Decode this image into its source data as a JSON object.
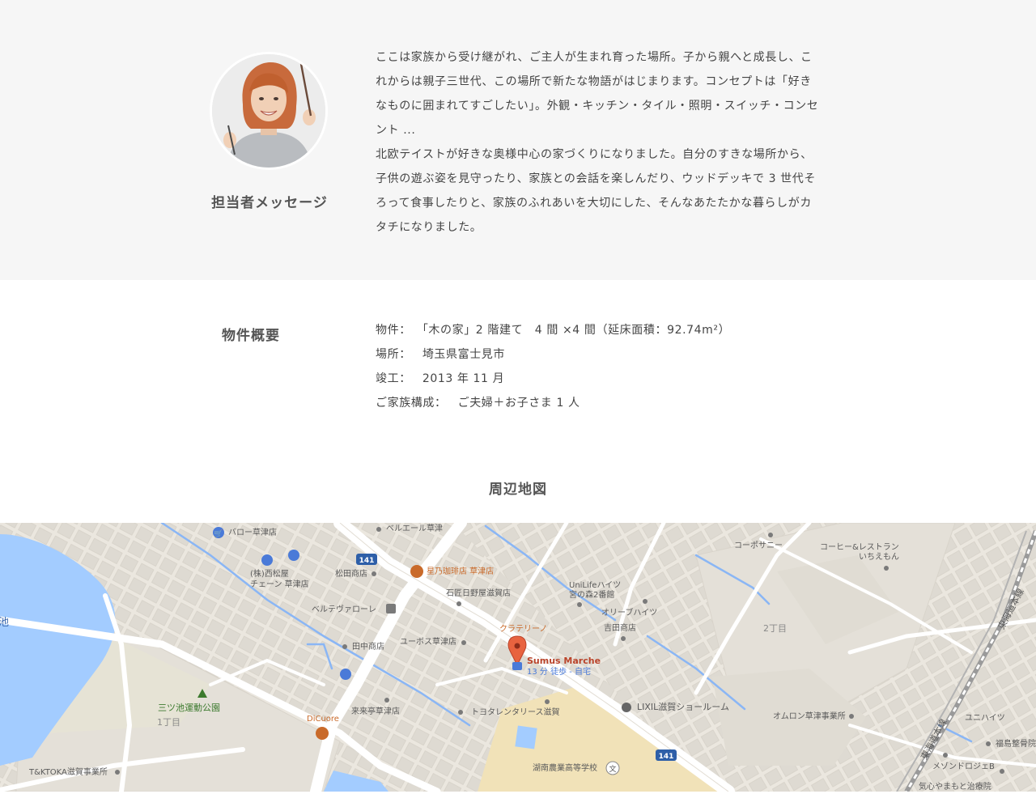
{
  "message": {
    "heading": "担当者メッセージ",
    "paragraphs": [
      "ここは家族から受け継がれ、ご主人が生まれ育った場所。子から親へと成長し、これからは親子三世代、この場所で新たな物語がはじまります。コンセプトは「好きなものに囲まれてすごしたい」。外観・キッチン・タイル・照明・スイッチ・コンセント ...",
      "北欧テイストが好きな奥様中心の家づくりになりました。自分のすきな場所から、子供の遊ぶ姿を見守ったり、家族との会話を楽しんだり、ウッドデッキで 3 世代そろって食事したりと、家族のふれあいを大切にした、そんなあたたかな暮らしがカタチになりました。"
    ]
  },
  "property": {
    "heading": "物件概要",
    "rows": [
      {
        "label": "物件：",
        "value": "「木の家」2 階建て　4 間 ×4 間（延床面積：92.74m²）"
      },
      {
        "label": "場所：",
        "value": "埼玉県富士見市"
      },
      {
        "label": "竣工：",
        "value": "2013 年 11 月"
      },
      {
        "label": "ご家族構成：",
        "value": "ご夫婦＋お子さま 1 人"
      }
    ]
  },
  "map": {
    "heading": "周辺地図",
    "labels": {
      "baro": "バロー草津店",
      "belair": "ベルエール草津",
      "route141a": "141",
      "route141b": "141",
      "nishimatsuya1": "(株)西松屋",
      "nishimatsuya2": "チェーン 草津店",
      "matsuda": "松田商店",
      "hoshino": "星乃珈琲店 草津店",
      "ishitaku": "石匠日野屋滋賀店",
      "unilife1": "UniLifeハイツ",
      "unilife2": "宮の森2番館",
      "olive": "オリーブハイツ",
      "coposunny": "コーポサニー",
      "coffee1": "コーヒー&レストラン",
      "coffee2": "いちえもん",
      "belteverole": "ベルテヴァローレ",
      "tanaka": "田中商店",
      "yubos": "ユーボス草津店",
      "clatelino": "クラテリーノ",
      "yoshida": "吉田商店",
      "chome2": "2丁目",
      "sumus": "Sumus Marche",
      "walk": "13 分 徒歩 - 自宅",
      "park": "三ツ池運動公園",
      "chome1": "1丁目",
      "dicuore": "DiCuore",
      "kuruku": "来来亭草津店",
      "toyota": "トヨタレンタリース滋賀",
      "lixil": "LIXIL滋賀ショールーム",
      "omron": "オムロン草津事業所",
      "tokaido1": "東海道本線",
      "tokaido2": "東海道本線",
      "unihaitsu": "ユニハイツ",
      "fukushima": "福島整骨院",
      "maison": "メゾンドロジェB",
      "kigokoro": "気心やまもと治療院",
      "tktoka": "T&KTOKA滋賀事業所",
      "konan": "湖南農業高等学校",
      "pond": "池"
    }
  },
  "colors": {
    "message_bg": "#f6f6f6",
    "map_land": "#ebe7df",
    "map_water": "#a3ccff",
    "map_road": "#ffffff",
    "map_building": "#dcd7cf",
    "map_park": "#dfe6d0",
    "school_area": "#f1e2b8",
    "pin": "#e8633f",
    "poi_blue": "#4a7ad8",
    "poi_orange": "#c96a2a",
    "park_text": "#3c7a2e"
  },
  "icons": {
    "pin": "map-pin-icon",
    "shop": "shopping-bag-icon",
    "cart": "cart-icon",
    "cafe": "coffee-cup-icon",
    "restaurant": "fork-knife-icon",
    "tree": "tree-icon",
    "school": "school-icon",
    "castle": "landmark-icon"
  }
}
